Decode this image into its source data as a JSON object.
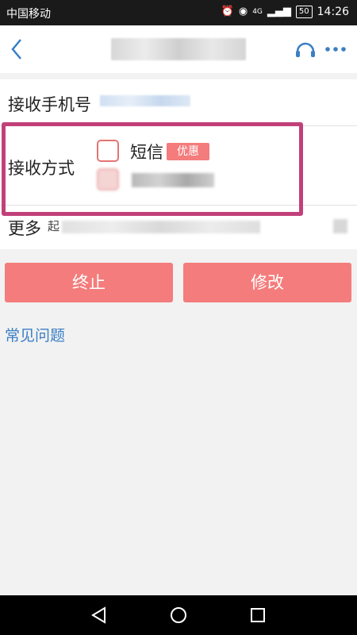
{
  "status_bar": {
    "carrier": "中国移动",
    "icons": [
      "alarm-icon",
      "eye-icon",
      "signal-icon"
    ],
    "network": "4G",
    "battery": "50",
    "time": "14:26"
  },
  "header": {
    "back_icon": "chevron-left-icon",
    "support_icon": "headset-icon",
    "more_icon": "more-dots-icon"
  },
  "form": {
    "phone_label": "接收手机号",
    "method_label": "接收方式",
    "option_sms_label": "短信",
    "option_sms_badge": "优惠",
    "more_label": "更多",
    "more_prefix": "起"
  },
  "actions": {
    "stop_label": "终止",
    "modify_label": "修改"
  },
  "links": {
    "faq": "常见问题"
  },
  "colors": {
    "accent": "#f47c7c",
    "highlight": "#c2407a",
    "link": "#3b7fc4"
  }
}
